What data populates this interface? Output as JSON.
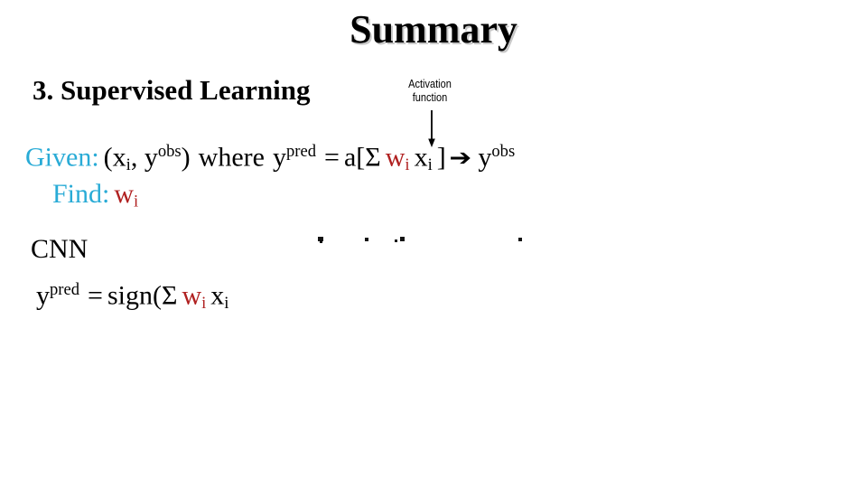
{
  "slide": {
    "title": "Summary",
    "section_heading": "3. Supervised Learning",
    "background_color": "#ffffff"
  },
  "callout": {
    "line1": "Activation",
    "line2": "function",
    "arrow_direction": "down",
    "points_to": "a["
  },
  "colors": {
    "label_cyan": "#29abd6",
    "weight_red": "#b02020",
    "text_black": "#000000",
    "title_shadow": "#c8c8c8"
  },
  "supervised": {
    "given_label": "Given:",
    "given_pair_open": "(x",
    "given_pair_sub1": "i",
    "given_pair_comma": ", y",
    "given_pair_sup1": "obs",
    "given_pair_close": ")",
    "where": "where",
    "y_pred_base": "y",
    "y_pred_sup": "pred",
    "equals": "=",
    "activation_fn": "a[",
    "sigma": "Σ",
    "weight_base": "w",
    "weight_sub": "i",
    "input_base": "x",
    "input_sub": "i",
    "bracket_close": "]",
    "arrow": "➔",
    "target_base": "y",
    "target_sup": "obs",
    "find_label": "Find:",
    "find_weight_base": "w",
    "find_weight_sub": "i"
  },
  "cnn": {
    "label": "CNN",
    "y_pred_base": "y",
    "y_pred_sup": "pred",
    "equals": "=",
    "sign_fn": "sign(",
    "sigma": "Σ",
    "weight_base": "w",
    "weight_sub": "i",
    "input_base": "x",
    "input_sub": "i"
  }
}
